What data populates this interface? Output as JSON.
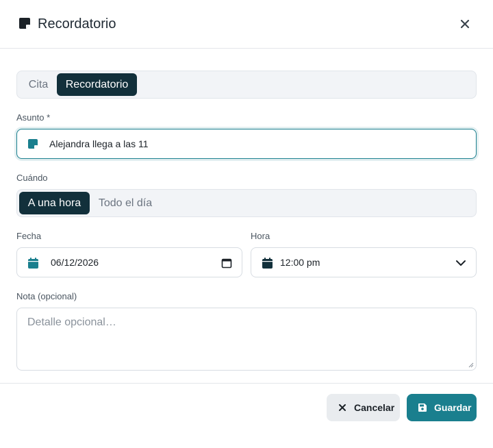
{
  "dialog": {
    "title": "Recordatorio",
    "title_icon": "sticky-note-icon",
    "close_icon": "close-icon"
  },
  "type_tabs": [
    {
      "label": "Cita",
      "active": false
    },
    {
      "label": "Recordatorio",
      "active": true
    }
  ],
  "subject": {
    "label": "Asunto *",
    "icon": "sticky-note-icon",
    "value": "Alejandra llega a las 11"
  },
  "when": {
    "label": "Cuándo",
    "options": [
      {
        "label": "A una hora",
        "active": true
      },
      {
        "label": "Todo el día",
        "active": false
      }
    ]
  },
  "date": {
    "label": "Fecha",
    "icon": "calendar-icon",
    "value": "06/12/2026",
    "picker_icon": "calendar-picker-icon"
  },
  "time": {
    "label": "Hora",
    "icon": "calendar-icon",
    "value": "12:00 pm",
    "dropdown_icon": "chevron-down-icon"
  },
  "note": {
    "label": "Nota (opcional)",
    "placeholder": "Detalle opcional…"
  },
  "footer": {
    "cancel_label": "Cancelar",
    "cancel_icon": "close-icon",
    "save_label": "Guardar",
    "save_icon": "save-icon"
  },
  "colors": {
    "accent": "#1a7f8e",
    "active_segment": "#12303b",
    "cancel_bg": "#e9ecef"
  }
}
